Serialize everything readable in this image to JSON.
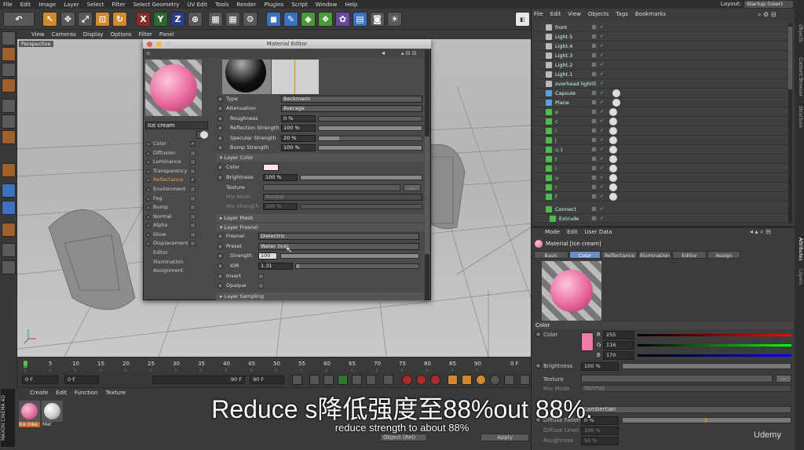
{
  "menubar": {
    "items": [
      "File",
      "Edit",
      "Image",
      "Layer",
      "Select",
      "Filter",
      "Select Geometry",
      "UV Edit",
      "Tools",
      "Render",
      "Plugins",
      "Script",
      "Window",
      "Help"
    ],
    "layout_label": "Layout:",
    "layout_value": "Startup (User)"
  },
  "viewport": {
    "menu": [
      "View",
      "Cameras",
      "Display",
      "Options",
      "Filter",
      "Panel"
    ],
    "camera_label": "Perspective"
  },
  "timeline": {
    "ticks": [
      "0",
      "5",
      "10",
      "15",
      "20",
      "25",
      "30",
      "35",
      "40",
      "45",
      "50",
      "55",
      "60",
      "65",
      "70",
      "75",
      "80",
      "85",
      "90"
    ],
    "end_frame": "0 F",
    "start_field": "0 F",
    "cur_field": "0 F",
    "end_field": "90 F",
    "max_field": "90 F"
  },
  "material_manager": {
    "menu": [
      "Create",
      "Edit",
      "Function",
      "Texture"
    ],
    "materials": [
      {
        "label": "Ice crea",
        "color": "#e46ea0"
      },
      {
        "label": "Mat",
        "color": "#c9c9c9"
      }
    ]
  },
  "material_editor": {
    "title": "Material Editor",
    "name_field": "Ice cream",
    "channels": [
      {
        "label": "Color",
        "checked": true
      },
      {
        "label": "Diffusion",
        "checked": false
      },
      {
        "label": "Luminance",
        "checked": false
      },
      {
        "label": "Transparency",
        "checked": false
      },
      {
        "label": "Reflectance",
        "checked": true,
        "active": true
      },
      {
        "label": "Environment",
        "checked": false
      },
      {
        "label": "Fog",
        "checked": false
      },
      {
        "label": "Bump",
        "checked": false
      },
      {
        "label": "Normal",
        "checked": false
      },
      {
        "label": "Alpha",
        "checked": false
      },
      {
        "label": "Glow",
        "checked": false
      },
      {
        "label": "Displacement",
        "checked": false
      },
      {
        "label": "Editor"
      },
      {
        "label": "Illumination"
      },
      {
        "label": "Assignment"
      }
    ],
    "type_label": "Type",
    "type_value": "Beckmann",
    "attenuation_label": "Attenuation",
    "attenuation_value": "Average",
    "roughness_label": "Roughness",
    "roughness_value": "0 %",
    "refl_strength_label": "Reflection Strength",
    "refl_strength_value": "100 %",
    "spec_strength_label": "Specular Strength",
    "spec_strength_value": "20 %",
    "bump_strength_label": "Bump Strength",
    "bump_strength_value": "100 %",
    "layer_color_label": "Layer Color",
    "lc_color_label": "Color",
    "lc_brightness_label": "Brightness",
    "lc_brightness_value": "100 %",
    "lc_texture_label": "Texture",
    "lc_mixmode_label": "Mix Mode",
    "lc_mixmode_value": "Normal",
    "lc_mixstrength_label": "Mix Strength",
    "lc_mixstrength_value": "100 %",
    "layer_mask_label": "Layer Mask",
    "layer_fresnel_label": "Layer Fresnel",
    "fresnel_label": "Fresnel",
    "fresnel_value": "Dielectric",
    "preset_label": "Preset",
    "preset_value": "Water (Ice)",
    "strength_label": "Strength",
    "strength_value": "100 %",
    "ior_label": "IOR",
    "ior_value": "1.31",
    "invert_label": "Invert",
    "opaque_label": "Opaque",
    "layer_sampling_label": "Layer Sampling",
    "more_button": "..."
  },
  "object_manager": {
    "menu": [
      "File",
      "Edit",
      "View",
      "Objects",
      "Tags",
      "Bookmarks"
    ],
    "objects": [
      {
        "name": "front",
        "icon": "light-icon"
      },
      {
        "name": "Light.5",
        "icon": "light-icon"
      },
      {
        "name": "Light.4",
        "icon": "light-icon"
      },
      {
        "name": "Light.3",
        "icon": "light-icon"
      },
      {
        "name": "Light.2",
        "icon": "light-icon"
      },
      {
        "name": "Light.1",
        "icon": "light-icon"
      },
      {
        "name": "overhead light",
        "icon": "light-icon"
      },
      {
        "name": "Capsule",
        "icon": "capsule-icon"
      },
      {
        "name": "Plane",
        "icon": "plane-icon"
      },
      {
        "name": "e",
        "icon": "null-icon"
      },
      {
        "name": "c",
        "icon": "null-icon"
      },
      {
        "name": "i",
        "icon": "null-icon"
      },
      {
        "name": "j",
        "icon": "null-icon"
      },
      {
        "name": "u.1",
        "icon": "null-icon"
      },
      {
        "name": "t",
        "icon": "null-icon"
      },
      {
        "name": "i",
        "icon": "null-icon"
      },
      {
        "name": "u",
        "icon": "null-icon"
      },
      {
        "name": "r",
        "icon": "null-icon"
      },
      {
        "name": "f",
        "icon": "null-icon"
      },
      {
        "name": "Connect",
        "icon": "connect-icon"
      },
      {
        "name": "Extrude",
        "icon": "extrude-icon"
      }
    ]
  },
  "attribute_manager": {
    "menu": [
      "Mode",
      "Edit",
      "User Data"
    ],
    "title": "Material [Ice cream]",
    "tabs": [
      "Basic",
      "Color",
      "Reflectance",
      "Illumination",
      "Editor",
      "Assign"
    ],
    "active_tab": "Color",
    "section": "Color",
    "color_label": "Color",
    "r_label": "R",
    "r_value": "255",
    "g_label": "G",
    "g_value": "116",
    "b_label": "B",
    "b_value": "170",
    "brightness_label": "Brightness",
    "brightness_value": "100 %",
    "texture_label": "Texture",
    "mixmode_label": "Mix Mode",
    "mixmode_value": "Normal",
    "model_value": "Lambertian",
    "diffuse_falloff_label": "Diffuse Falloff",
    "diffuse_falloff_value": "0 %",
    "diffuse_level_label": "Diffuse Level",
    "diffuse_level_value": "100 %",
    "roughness_label": "Roughness",
    "roughness_value": "50 %",
    "apply_label": "Apply",
    "object_rel_label": "Object (Rel)",
    "swatch_color": "#f57aa8"
  },
  "right_tabs": [
    "Objects",
    "Content Browser",
    "Structure",
    "Attributes",
    "Layers"
  ],
  "subtitles": {
    "overlay_big": "Reduce s降低强度至88%out 88%.",
    "overlay_small": "reduce strength to about 88%"
  },
  "watermark": "Udemy",
  "brand": "MAXON CINEMA 4D"
}
